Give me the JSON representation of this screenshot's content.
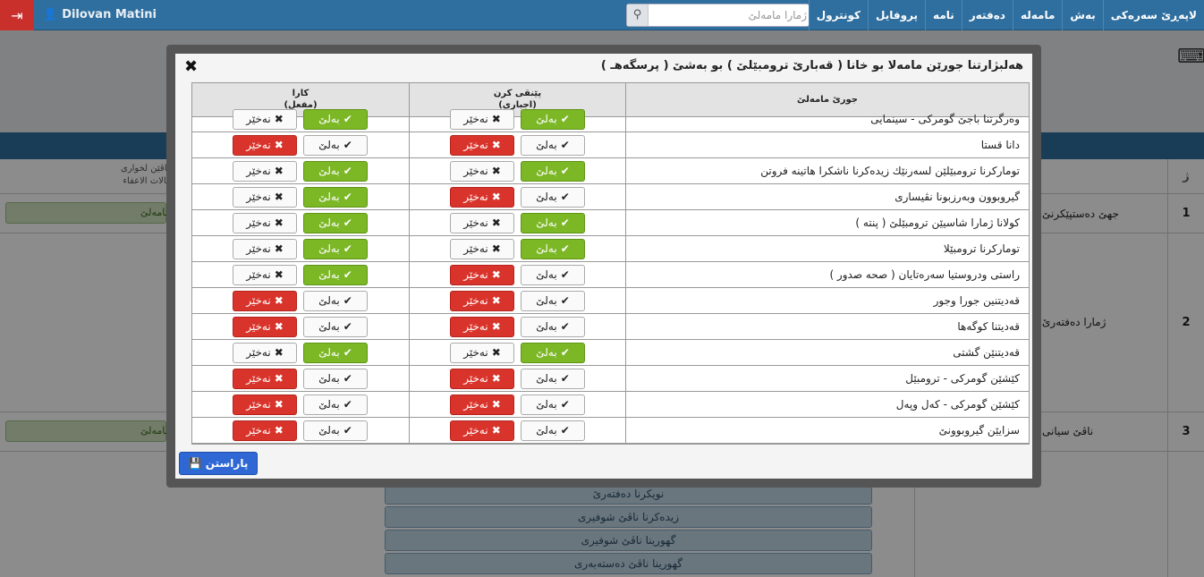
{
  "navbar": {
    "user_name": "Dilovan Matini",
    "search_placeholder": "ژمارا مامەلێ",
    "items": [
      "لاپەڕێ سەرەکی",
      "بەش",
      "مامەلە",
      "دەفتەر",
      "نامە",
      "پروفایل",
      "کونترول"
    ]
  },
  "modal": {
    "title": "هەلبژارتنا جورێن مامەلا بو خانا ( قەبارێ ترومبێلێ ) بو بەشێ ( پرسگەهـ )",
    "col_name": "جورێ مامەلێ",
    "col_required": "پێنقی کرن",
    "col_required_sub": "(اجباري)",
    "col_active": "کارا",
    "col_active_sub": "(مفعل)",
    "yes_label": "بەلێ",
    "no_label": "نەخێر",
    "save_label": "پاراستن",
    "rows": [
      {
        "name": "وەرگرتنا باجێ گومرکی - سینمایی",
        "required": "yes",
        "active": "yes"
      },
      {
        "name": "دانا قستا",
        "required": "no",
        "active": "no"
      },
      {
        "name": "تومارکرنا ترومبێلێن لسەرنێك زیدەکرنا ناشکرا هاتینە فروتن",
        "required": "yes",
        "active": "yes"
      },
      {
        "name": "گیروبوون وبەرزبونا نڤیساری",
        "required": "no",
        "active": "yes"
      },
      {
        "name": "کولانا ژمارا شاسیێن ترومبێلێ ( پنته )",
        "required": "yes",
        "active": "yes"
      },
      {
        "name": "تومارکرنا ترومبێلا",
        "required": "yes",
        "active": "yes"
      },
      {
        "name": "راستی ودروستیا سەرەتایان ( صحه صدور )",
        "required": "no",
        "active": "yes"
      },
      {
        "name": "قەدیتنین جورا وجور",
        "required": "no",
        "active": "no"
      },
      {
        "name": "قەدیتنا کوگەها",
        "required": "no",
        "active": "no"
      },
      {
        "name": "قەدیتنێن گشتی",
        "required": "yes",
        "active": "yes"
      },
      {
        "name": "کێشێن گومرکی - ترومبێل",
        "required": "no",
        "active": "no"
      },
      {
        "name": "کێشێن گومرکی - کەل وپەل",
        "required": "no",
        "active": "no"
      },
      {
        "name": "سزایێن گیروبوونێ",
        "required": "no",
        "active": "no"
      }
    ]
  },
  "background": {
    "header_small_1": "ماڤێن لخواری",
    "header_small_2": "حالات الاعفاء",
    "row_numbers": [
      "1",
      "2",
      "3"
    ],
    "col_header_num": "ژ",
    "row1_text": "جهێ دەستپێکرنێ",
    "row2_text": "ژمارا دەفتەرێ",
    "row3_text": "ناڤێ سیانی",
    "green_label": "مامەلێ",
    "list_items": [
      "نویکرنا دەفتەرێ",
      "زیدەکرنا ناڤێ شوفیری",
      "گهورینا ناڤێ شوفیری",
      "گهورینا ناڤێ دەستەبەری"
    ]
  },
  "colors": {
    "navbar": "#2f6f9f",
    "green": "#7cb726",
    "red": "#d9342b",
    "save": "#2f68d4",
    "logout": "#c9302c"
  }
}
